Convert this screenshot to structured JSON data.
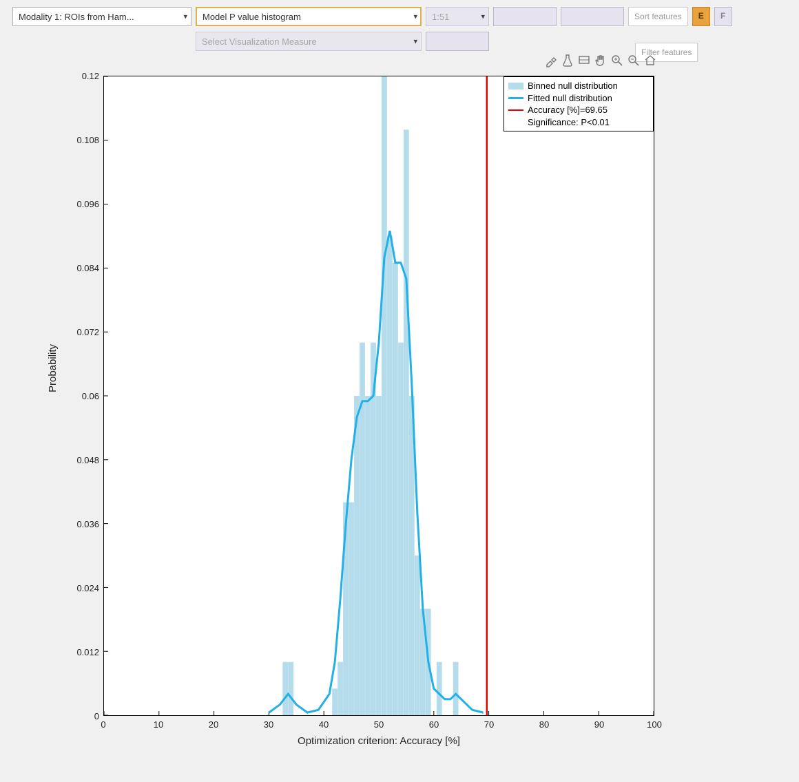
{
  "toolbar": {
    "modality_label": "Modality 1: ROIs from Ham...",
    "plot_label": "Model P value histogram",
    "range_label": "1:51",
    "sort_label": "Sort features",
    "filter_label": "Filter features",
    "e_label": "E",
    "f_label": "F",
    "viz_label": "Select Visualization Measure"
  },
  "legend": {
    "l1": "Binned null distribution",
    "l2": "Fitted null distribution",
    "l3": "Accuracy [%]=69.65",
    "l4": "Significance: P<0.01"
  },
  "axes": {
    "ylabel": "Probability",
    "xlabel": "Optimization criterion: Accuracy [%]",
    "yticks": [
      "0",
      "0.012",
      "0.024",
      "0.036",
      "0.048",
      "0.06",
      "0.072",
      "0.084",
      "0.096",
      "0.108",
      "0.12"
    ],
    "xticks": [
      "0",
      "10",
      "20",
      "30",
      "40",
      "50",
      "60",
      "70",
      "80",
      "90",
      "100"
    ]
  },
  "chart_data": {
    "type": "bar+line",
    "title": "Model P value histogram",
    "xlabel": "Optimization criterion: Accuracy [%]",
    "ylabel": "Probability",
    "xlim": [
      0,
      100
    ],
    "ylim": [
      0,
      0.12
    ],
    "accuracy_line_x": 69.65,
    "bars": [
      {
        "x": 33,
        "y": 0.01
      },
      {
        "x": 34,
        "y": 0.01
      },
      {
        "x": 42,
        "y": 0.005
      },
      {
        "x": 43,
        "y": 0.01
      },
      {
        "x": 44,
        "y": 0.04
      },
      {
        "x": 45,
        "y": 0.04
      },
      {
        "x": 46,
        "y": 0.06
      },
      {
        "x": 47,
        "y": 0.07
      },
      {
        "x": 48,
        "y": 0.06
      },
      {
        "x": 49,
        "y": 0.07
      },
      {
        "x": 50,
        "y": 0.06
      },
      {
        "x": 51,
        "y": 0.12
      },
      {
        "x": 52,
        "y": 0.09
      },
      {
        "x": 53,
        "y": 0.085
      },
      {
        "x": 54,
        "y": 0.07
      },
      {
        "x": 55,
        "y": 0.11
      },
      {
        "x": 56,
        "y": 0.06
      },
      {
        "x": 57,
        "y": 0.03
      },
      {
        "x": 58,
        "y": 0.02
      },
      {
        "x": 59,
        "y": 0.02
      },
      {
        "x": 61,
        "y": 0.01
      },
      {
        "x": 64,
        "y": 0.01
      }
    ],
    "fit_line": [
      {
        "x": 30,
        "y": 0.0005
      },
      {
        "x": 32,
        "y": 0.002
      },
      {
        "x": 33.5,
        "y": 0.004
      },
      {
        "x": 35,
        "y": 0.002
      },
      {
        "x": 37,
        "y": 0.0005
      },
      {
        "x": 39,
        "y": 0.001
      },
      {
        "x": 41,
        "y": 0.004
      },
      {
        "x": 42,
        "y": 0.01
      },
      {
        "x": 43,
        "y": 0.022
      },
      {
        "x": 44,
        "y": 0.036
      },
      {
        "x": 45,
        "y": 0.048
      },
      {
        "x": 46,
        "y": 0.056
      },
      {
        "x": 47,
        "y": 0.059
      },
      {
        "x": 48,
        "y": 0.059
      },
      {
        "x": 49,
        "y": 0.06
      },
      {
        "x": 50,
        "y": 0.07
      },
      {
        "x": 51,
        "y": 0.086
      },
      {
        "x": 52,
        "y": 0.091
      },
      {
        "x": 53,
        "y": 0.085
      },
      {
        "x": 54,
        "y": 0.085
      },
      {
        "x": 55,
        "y": 0.082
      },
      {
        "x": 56,
        "y": 0.062
      },
      {
        "x": 57,
        "y": 0.038
      },
      {
        "x": 58,
        "y": 0.02
      },
      {
        "x": 59,
        "y": 0.01
      },
      {
        "x": 60,
        "y": 0.005
      },
      {
        "x": 62,
        "y": 0.003
      },
      {
        "x": 63,
        "y": 0.003
      },
      {
        "x": 64,
        "y": 0.004
      },
      {
        "x": 65,
        "y": 0.003
      },
      {
        "x": 67,
        "y": 0.001
      },
      {
        "x": 69,
        "y": 0.0005
      }
    ],
    "legend": [
      "Binned null distribution",
      "Fitted null distribution",
      "Accuracy [%]=69.65",
      "Significance: P<0.01"
    ]
  }
}
